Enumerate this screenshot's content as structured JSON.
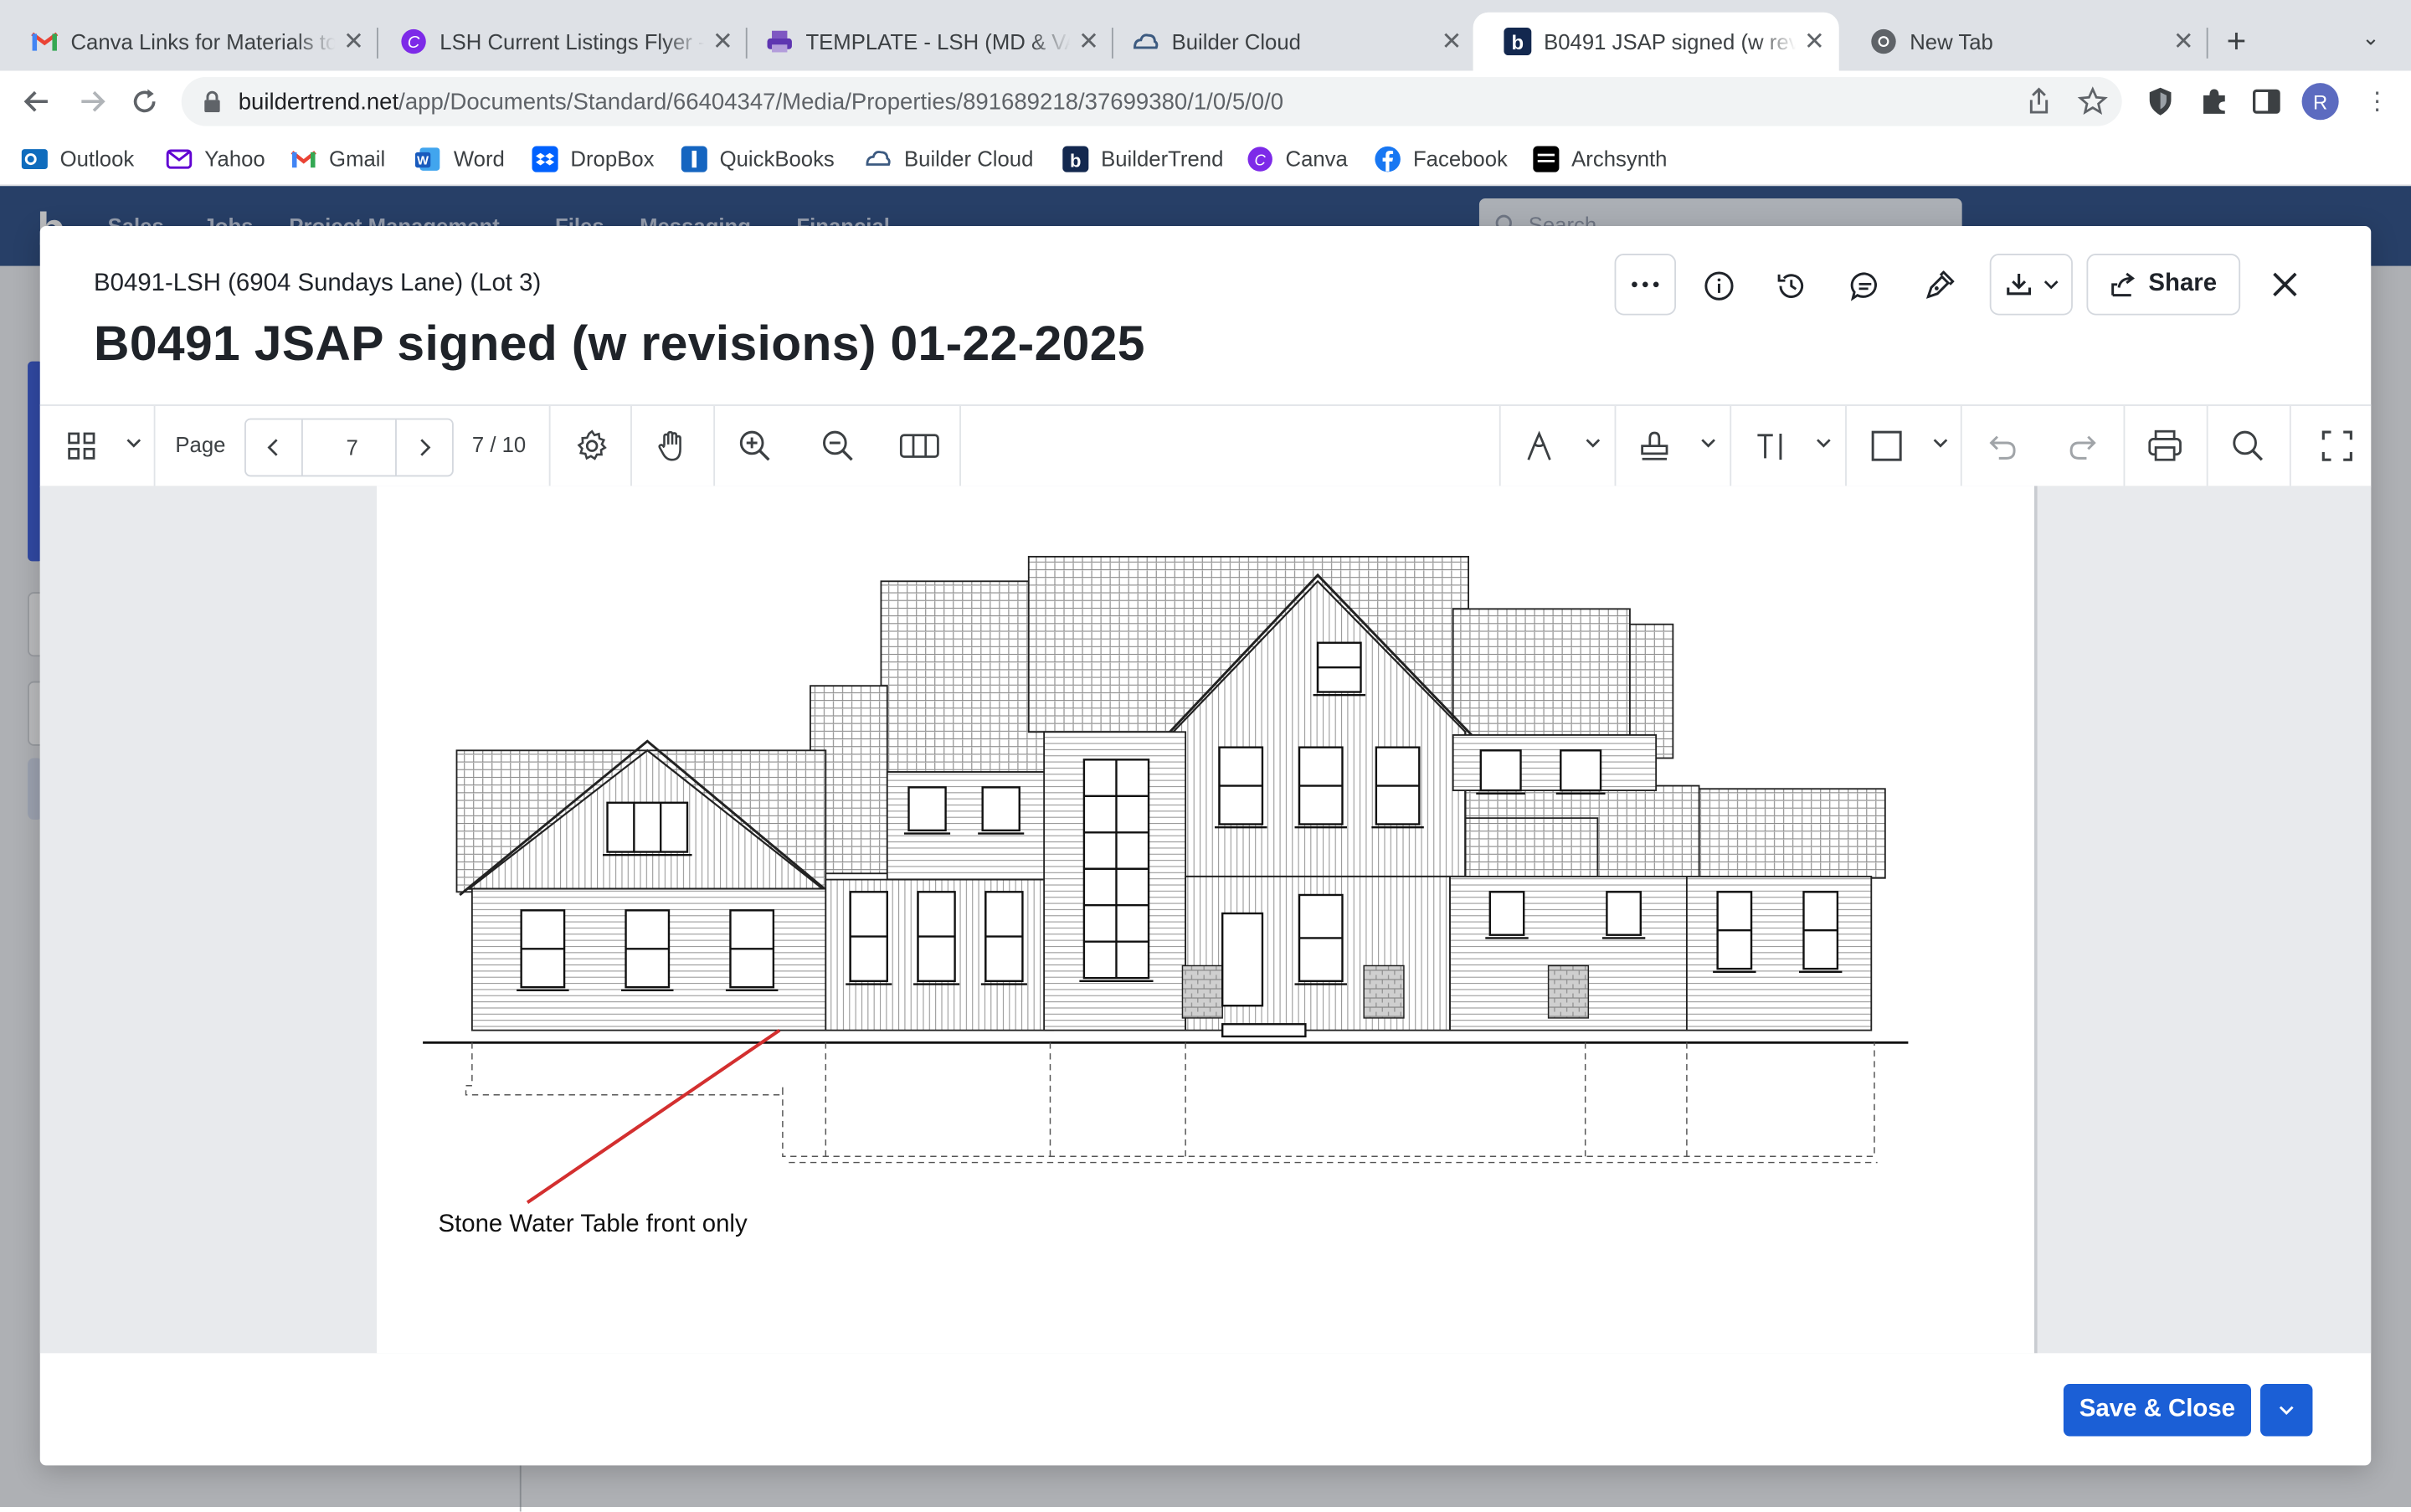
{
  "browser": {
    "tabs": [
      {
        "title": "Canva Links for Materials to",
        "favicon": "gmail-icon"
      },
      {
        "title": "LSH Current Listings Flyer -",
        "favicon": "canva-icon"
      },
      {
        "title": "TEMPLATE - LSH (MD & VA",
        "favicon": "printer-icon"
      },
      {
        "title": "Builder Cloud",
        "favicon": "builder-cloud-icon"
      },
      {
        "title": "B0491 JSAP signed (w revi",
        "favicon": "buildertrend-icon",
        "active": true
      },
      {
        "title": "New Tab",
        "favicon": "chrome-icon"
      }
    ],
    "url_host": "buildertrend.net",
    "url_path": "/app/Documents/Standard/66404347/Media/Properties/891689218/37699380/1/0/5/0/0",
    "profile_initial": "R",
    "bookmarks": [
      {
        "label": "Outlook",
        "icon": "outlook-icon",
        "color": "#0f6cbd"
      },
      {
        "label": "Yahoo",
        "icon": "yahoo-icon",
        "color": "#6001d2"
      },
      {
        "label": "Gmail",
        "icon": "gmail-icon",
        "color": "#ea4335"
      },
      {
        "label": "Word",
        "icon": "word-icon",
        "color": "#185abd"
      },
      {
        "label": "DropBox",
        "icon": "dropbox-icon",
        "color": "#0061fe"
      },
      {
        "label": "QuickBooks",
        "icon": "quickbooks-icon",
        "color": "#2ca01c"
      },
      {
        "label": "Builder Cloud",
        "icon": "builder-cloud-icon",
        "color": "#3c5a80"
      },
      {
        "label": "BuilderTrend",
        "icon": "buildertrend-icon",
        "color": "#13284f"
      },
      {
        "label": "Canva",
        "icon": "canva-icon",
        "color": "#7d2ae8"
      },
      {
        "label": "Facebook",
        "icon": "facebook-icon",
        "color": "#1877f2"
      },
      {
        "label": "Archsynth",
        "icon": "archsynth-icon",
        "color": "#000000"
      }
    ]
  },
  "app": {
    "nav": [
      "Sales",
      "Jobs",
      "Project Management",
      "Files",
      "Messaging",
      "Financial"
    ],
    "search_placeholder": "Search..."
  },
  "modal": {
    "breadcrumb": "B0491-LSH (6904 Sundays Lane) (Lot 3)",
    "title": "B0491 JSAP signed (w revisions) 01-22-2025",
    "share_label": "Share",
    "save_label": "Save & Close"
  },
  "viewer": {
    "page_label": "Page",
    "current_page": "7",
    "page_count": "7 / 10",
    "annotation_text": "Stone Water Table front only",
    "annotation_color": "#d32f2f"
  },
  "colors": {
    "primary": "#1b5fd6",
    "app_header": "#1c3f7a"
  }
}
